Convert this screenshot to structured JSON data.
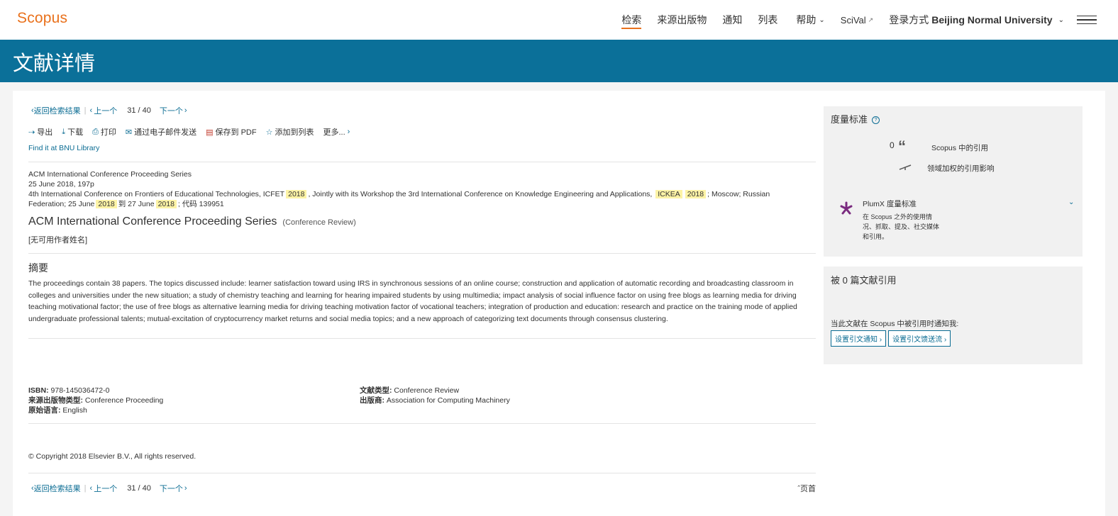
{
  "app": {
    "logo": "Scopus"
  },
  "nav": {
    "search": "检索",
    "sources": "来源出版物",
    "alerts": "通知",
    "lists": "列表",
    "help": "帮助",
    "scival": "SciVal",
    "login_prefix": "登录方式",
    "login_institution": "Beijing Normal University"
  },
  "page": {
    "title": "文献详情"
  },
  "pager": {
    "back": "返回检索结果",
    "prev": "上一个",
    "current": "31",
    "total": "/ 40",
    "next": "下一个"
  },
  "toolbar": {
    "export": "导出",
    "download": "下载",
    "print": "打印",
    "email": "通过电子邮件发送",
    "save_pdf": "保存到 PDF",
    "add_list": "添加到列表",
    "more": "更多..."
  },
  "find_library": "Find it at BNU Library",
  "source": {
    "series": "ACM International Conference Proceeding Series",
    "date_pages": "25 June 2018, 197p",
    "conf_a": "4th International Conference on Frontiers of Educational Technologies, ICFET",
    "year1": "2018",
    "conf_b": ", Jointly with its Workshop the 3rd International Conference on Knowledge Engineering and Applications,",
    "ickea": "ICKEA",
    "year2": "2018",
    "conf_c": "; Moscow; Russian Federation; 25 June",
    "year3": "2018",
    "conf_d": "到 27 June",
    "year4": "2018",
    "conf_e": "; 代码 139951"
  },
  "doc": {
    "title": "ACM International Conference Proceeding Series",
    "type": "(Conference Review)",
    "authors": "[无可用作者姓名]"
  },
  "abstract": {
    "heading": "摘要",
    "text": "The proceedings contain 38 papers. The topics discussed include: learner satisfaction toward using IRS in synchronous sessions of an online course; construction and application of automatic recording and broadcasting classroom in colleges and universities under the new situation; a study of chemistry teaching and learning for hearing impaired students by using multimedia; impact analysis of social influence factor on using free blogs as learning media for driving teaching motivational factor; the use of free blogs as alternative learning media for driving teaching motivation factor of vocational teachers; integration of production and education: research and practice on the training mode of applied undergraduate professional talents; mutual-excitation of cryptocurrency market returns and social media topics; and a new approach of categorizing text documents through consensus clustering."
  },
  "meta": {
    "isbn_label": "ISBN:",
    "isbn": "978-145036472-0",
    "source_type_label": "来源出版物类型:",
    "source_type": "Conference Proceeding",
    "lang_label": "原始语言:",
    "lang": "English",
    "doctype_label": "文献类型:",
    "doctype": "Conference Review",
    "publisher_label": "出版商:",
    "publisher": "Association for Computing Machinery"
  },
  "copyright": "© Copyright 2018 Elsevier B.V., All rights reserved.",
  "page_top": "页首",
  "metrics": {
    "heading": "度量标准",
    "citations_count": "0",
    "citations_label": "Scopus 中的引用",
    "fwci_label": "领域加权的引用影响",
    "plumx_title": "PlumX 度量标准",
    "plumx_desc_1": "在 Scopus 之外的使用情",
    "plumx_desc_2": "况、抓取、提及、社交媒体",
    "plumx_desc_3": "和引用。"
  },
  "cited_by": {
    "heading": "被 0 篇文献引用",
    "notify_text": "当此文献在 Scopus 中被引用时通知我:",
    "btn_alert": "设置引文通知",
    "btn_feed": "设置引文馈送流"
  },
  "colors": {
    "accent": "#e9711c",
    "band": "#0b7099",
    "link": "#0b6c93",
    "highlight": "#fdf3a6"
  }
}
